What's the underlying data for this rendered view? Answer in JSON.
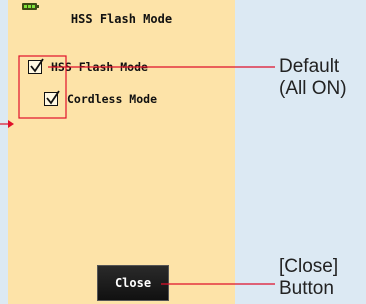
{
  "screen": {
    "title": "HSS Flash Mode",
    "options": [
      {
        "label": "HSS Flash Mode",
        "checked": true
      },
      {
        "label": "Cordless Mode",
        "checked": true
      }
    ],
    "close_label": "Close"
  },
  "callouts": {
    "default_line1": "Default",
    "default_line2": "(All ON)",
    "close_line1": "[Close]",
    "close_line2": "Button"
  },
  "colors": {
    "screen_bg": "#fde3a8",
    "page_bg": "#dce9f3",
    "callout_line": "#e0102a"
  }
}
